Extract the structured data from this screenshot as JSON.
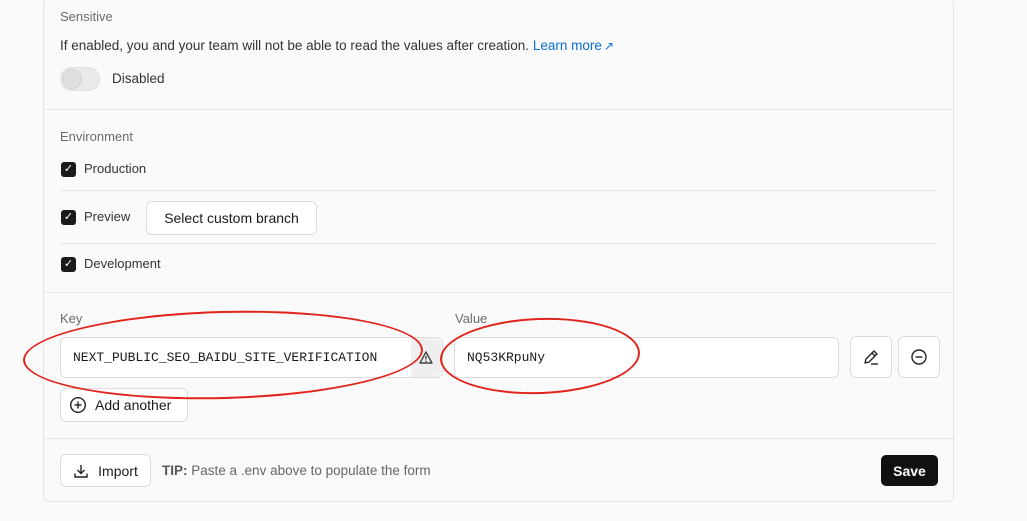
{
  "sensitive": {
    "title": "Sensitive",
    "description": "If enabled, you and your team will not be able to read the values after creation.",
    "learn_more": "Learn more",
    "toggle_state": "Disabled"
  },
  "environment": {
    "title": "Environment",
    "options": [
      {
        "label": "Production",
        "checked": true
      },
      {
        "label": "Preview",
        "checked": true
      },
      {
        "label": "Development",
        "checked": true
      }
    ],
    "custom_branch_label": "Select custom branch"
  },
  "vars": {
    "key_label": "Key",
    "value_label": "Value",
    "key_value": "NEXT_PUBLIC_SEO_BAIDU_SITE_VERIFICATION",
    "value_value": "NQ53KRpuNy",
    "add_another": "Add another"
  },
  "footer": {
    "import_label": "Import",
    "tip_prefix": "TIP:",
    "tip_text": "Paste a .env above to populate the form",
    "save_label": "Save"
  },
  "annotation_color": "#e0231c"
}
